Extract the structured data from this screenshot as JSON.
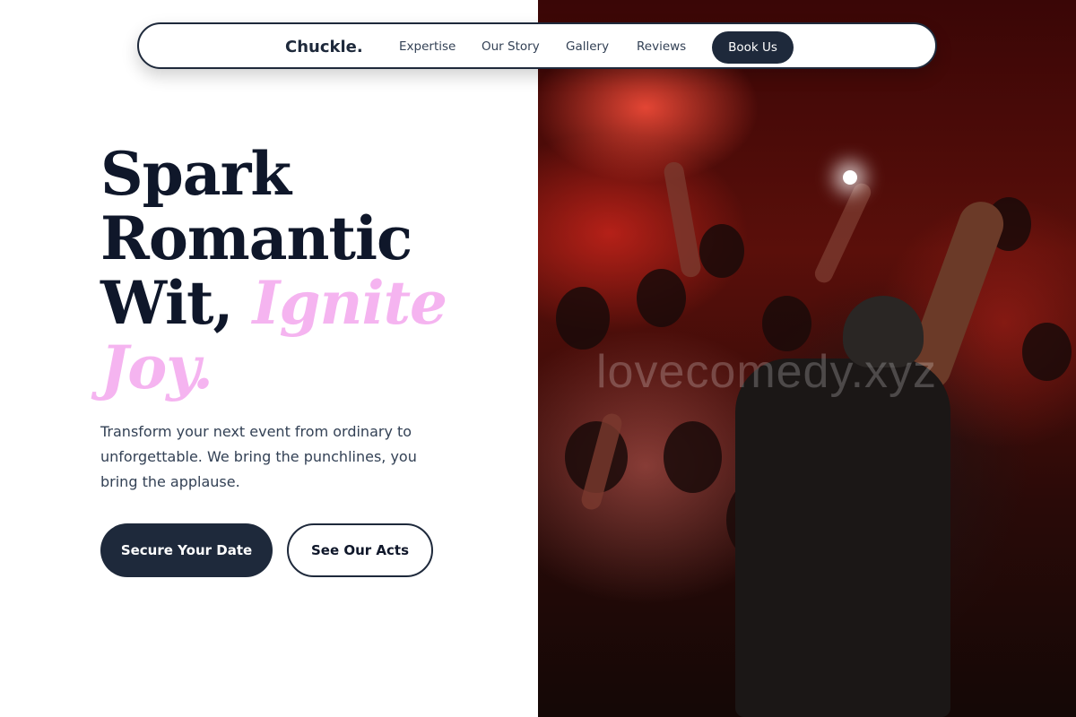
{
  "nav": {
    "brand": "Chuckle.",
    "links": [
      "Expertise",
      "Our Story",
      "Gallery",
      "Reviews"
    ],
    "cta": "Book Us"
  },
  "hero": {
    "headline_line1": "Spark",
    "headline_line2": "Romantic",
    "headline_line3_plain": "Wit, ",
    "headline_line3_accent": "Ignite",
    "headline_line4_accent": "Joy.",
    "subtext": "Transform your next event from ordinary to unforgettable. We bring the punchlines, you bring the applause.",
    "primary_button": "Secure Your Date",
    "secondary_button": "See Our Acts"
  },
  "image": {
    "watermark": "lovecomedy.xyz"
  },
  "colors": {
    "primary": "#1e293b",
    "accent": "#f5b4f0",
    "background": "#ffffff"
  }
}
